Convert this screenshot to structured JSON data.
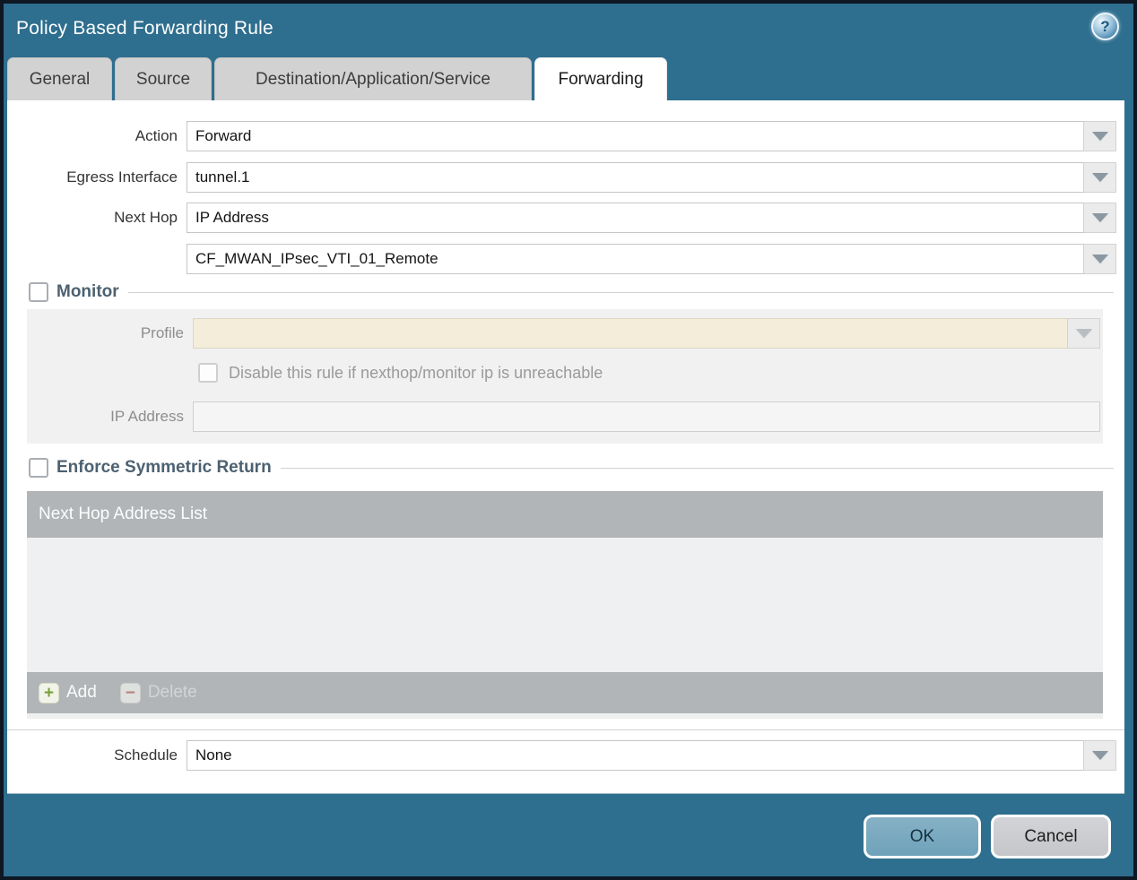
{
  "dialog": {
    "title": "Policy Based Forwarding Rule",
    "help_glyph": "?"
  },
  "tabs": [
    {
      "label": "General",
      "active": false
    },
    {
      "label": "Source",
      "active": false
    },
    {
      "label": "Destination/Application/Service",
      "active": false
    },
    {
      "label": "Forwarding",
      "active": true
    }
  ],
  "form": {
    "action": {
      "label": "Action",
      "value": "Forward"
    },
    "egress_interface": {
      "label": "Egress Interface",
      "value": "tunnel.1"
    },
    "next_hop": {
      "label": "Next Hop",
      "value": "IP Address"
    },
    "next_hop_address": {
      "value": "CF_MWAN_IPsec_VTI_01_Remote"
    },
    "schedule": {
      "label": "Schedule",
      "value": "None"
    }
  },
  "monitor": {
    "title": "Monitor",
    "checked": false,
    "profile_label": "Profile",
    "profile_value": "",
    "disable_rule_label": "Disable this rule if nexthop/monitor ip is unreachable",
    "disable_rule_checked": false,
    "ip_address_label": "IP Address",
    "ip_address_value": ""
  },
  "symmetric_return": {
    "title": "Enforce Symmetric Return",
    "checked": false,
    "table": {
      "header": "Next Hop Address List",
      "rows": []
    },
    "add_label": "Add",
    "add_glyph": "+",
    "delete_label": "Delete",
    "delete_glyph": "−",
    "delete_enabled": false
  },
  "footer": {
    "ok_label": "OK",
    "cancel_label": "Cancel"
  },
  "colors": {
    "titlebar": "#2e6e8e",
    "active_tab": "#ffffff",
    "inactive_tab": "#d2d2d2",
    "table_header": "#b1b5b8",
    "disabled_combo": "#f3edda",
    "ok_button": "#6ea2ba",
    "cancel_button": "#c4c6c9",
    "add_icon_green": "#7ba03b",
    "delete_icon_red": "#b58077"
  }
}
